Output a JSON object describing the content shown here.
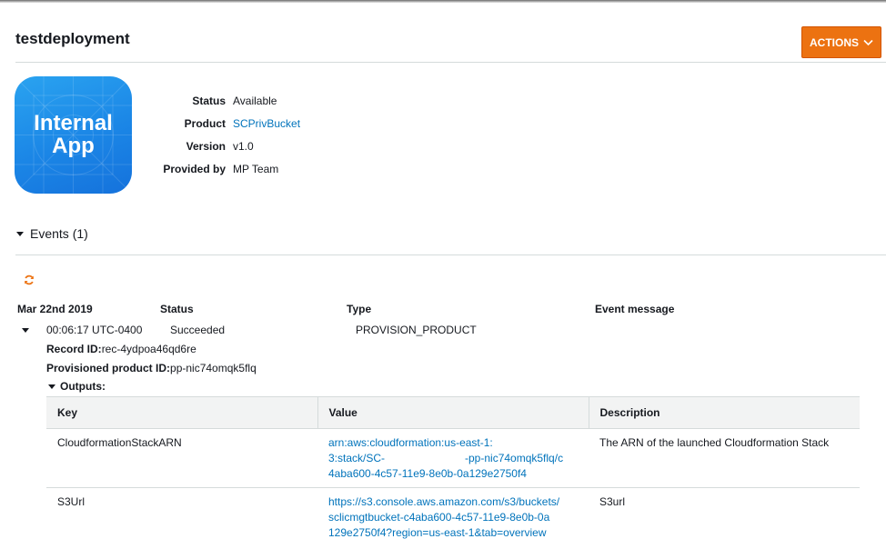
{
  "page": {
    "title": "testdeployment",
    "actions_label": "ACTIONS"
  },
  "app_icon": {
    "line1": "Internal",
    "line2": "App",
    "colors": {
      "top": "#2aa3f0",
      "bottom": "#1572dc"
    }
  },
  "details": [
    {
      "label": "Status",
      "value": "Available",
      "link": false
    },
    {
      "label": "Product",
      "value": "SCPrivBucket",
      "link": true
    },
    {
      "label": "Version",
      "value": "v1.0",
      "link": false
    },
    {
      "label": "Provided by",
      "value": "MP Team",
      "link": false
    }
  ],
  "events": {
    "header": "Events (1)",
    "refresh_icon": "refresh-icon",
    "columns": {
      "date": "Mar 22nd 2019",
      "status": "Status",
      "type": "Type",
      "message": "Event message"
    },
    "row": {
      "time": "00:06:17 UTC-0400",
      "status": "Succeeded",
      "type": "PROVISION_PRODUCT",
      "record_label": "Record ID:",
      "record_value": "rec-4ydpoa46qd6re",
      "provisioned_label": "Provisioned product ID:",
      "provisioned_value": "pp-nic74omqk5flq",
      "outputs_label": "Outputs:"
    }
  },
  "outputs_table": {
    "headers": [
      "Key",
      "Value",
      "Description"
    ],
    "rows": [
      {
        "key": "CloudformationStackARN",
        "value_lines": [
          "arn:aws:cloudformation:us-east-1:",
          "3:stack/SC-",
          "-pp-nic74omqk5flq/c",
          "4aba600-4c57-11e9-8e0b-0a129e2750f4"
        ],
        "description": "The ARN of the launched Cloudformation Stack"
      },
      {
        "key": "S3Url",
        "value_lines": [
          "https://s3.console.aws.amazon.com/s3/buckets/",
          "sclicmgtbucket-c4aba600-4c57-11e9-8e0b-0a",
          "129e2750f4?region=us-east-1&tab=overview"
        ],
        "description": "S3url"
      }
    ]
  },
  "colors": {
    "accent": "#ec7211",
    "link": "#0073bb",
    "refresh": "#ec7211"
  }
}
